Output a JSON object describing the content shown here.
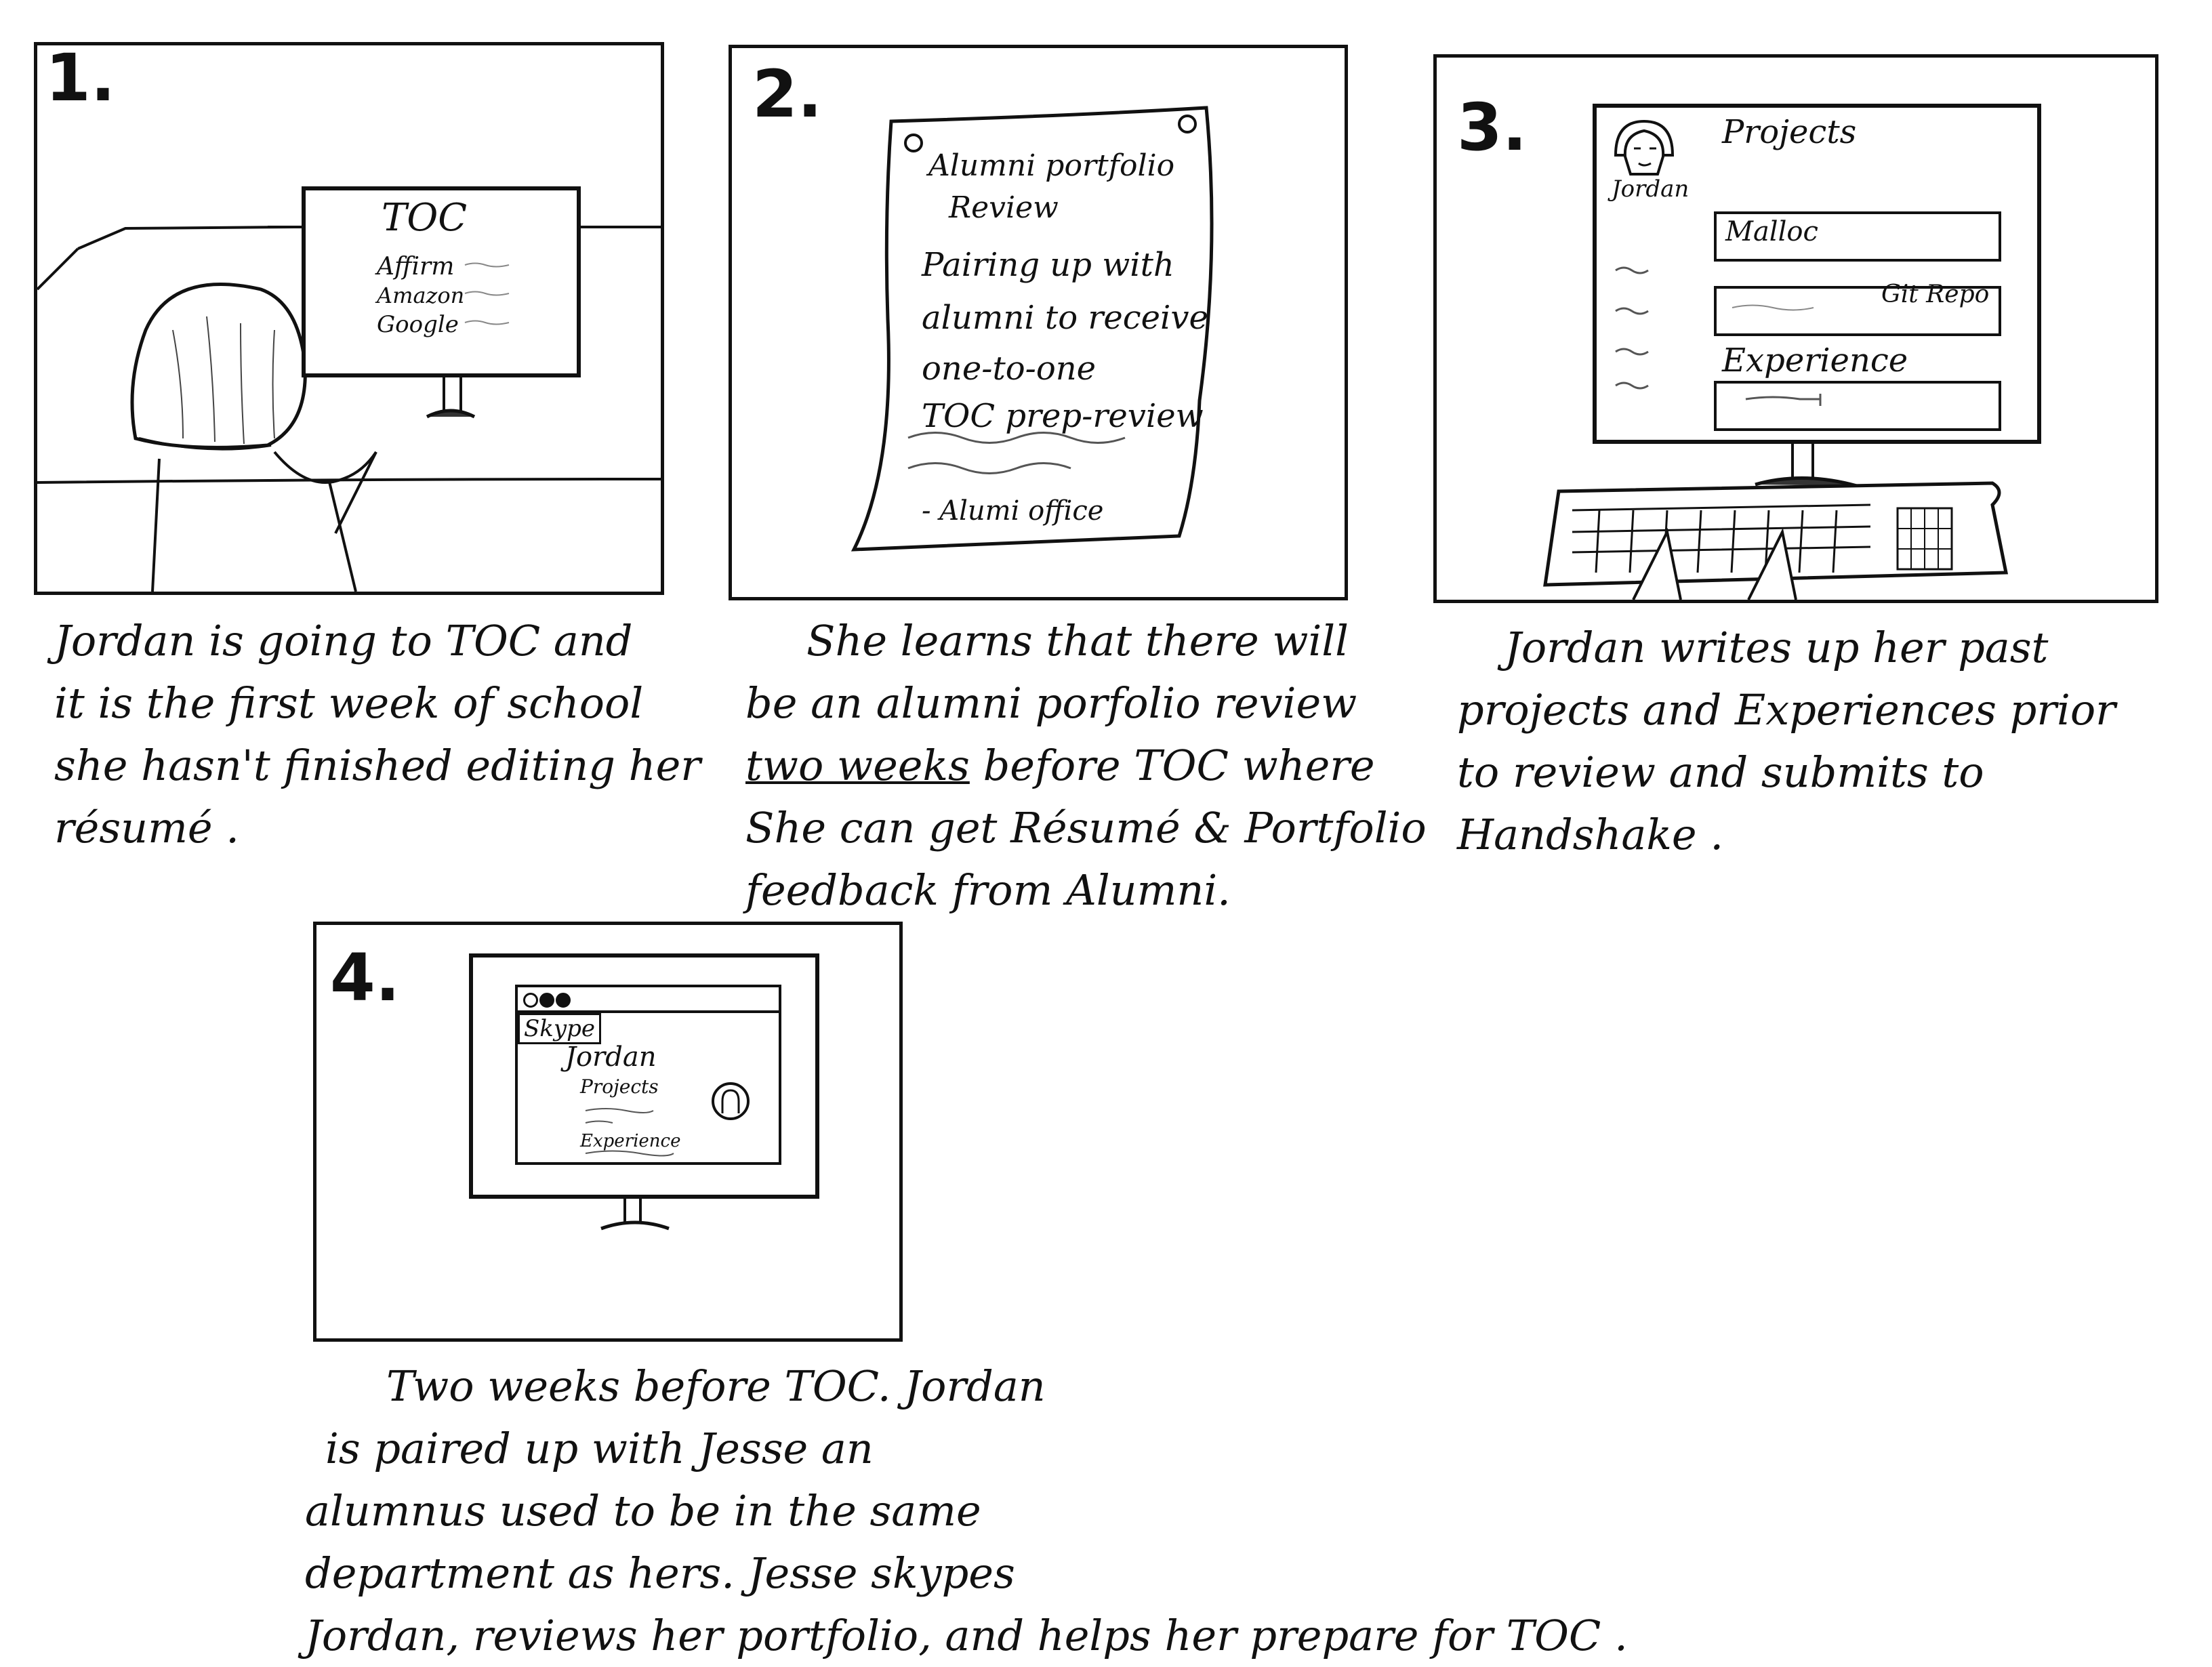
{
  "panel1": {
    "number": "1.",
    "screen": {
      "title": "TOC",
      "companies": [
        "Affirm",
        "Amazon",
        "Google"
      ]
    },
    "caption": [
      "Jordan is going to TOC and",
      "it is the first week of school",
      "she hasn't finished editing her",
      "résumé ."
    ]
  },
  "panel2": {
    "number": "2.",
    "flyer": {
      "heading": [
        "Alumni portfolio",
        "Review"
      ],
      "body": [
        "Pairing up with",
        "alumni to receive",
        "one-to-one",
        "TOC prep-review"
      ],
      "signature": "- Alumi office"
    },
    "caption": {
      "line1": "She learns that there will",
      "line2": "be an alumni porfolio review",
      "line3_underlined": "two weeks",
      "line3_rest": " before TOC where",
      "line4": "She can get Résumé & Portfolio",
      "line5": "feedback from Alumni."
    }
  },
  "panel3": {
    "number": "3.",
    "screen": {
      "user": "Jordan",
      "projects_heading": "Projects",
      "project_name": "Malloc",
      "repo_label": "Git Repo",
      "experience_heading": "Experience"
    },
    "caption": [
      "Jordan writes up her past",
      "projects and Experiences prior",
      "to review and submits to",
      "Handshake ."
    ]
  },
  "panel4": {
    "number": "4.",
    "screen": {
      "app_name": "Skype",
      "user": "Jordan",
      "projects": "Projects",
      "experience": "Experience"
    },
    "caption": [
      "Two weeks before TOC. Jordan",
      "is paired up with Jesse an",
      "alumnus used to be in the same",
      "department as hers. Jesse skypes",
      "Jordan, reviews her portfolio, and helps her prepare for TOC ."
    ]
  }
}
